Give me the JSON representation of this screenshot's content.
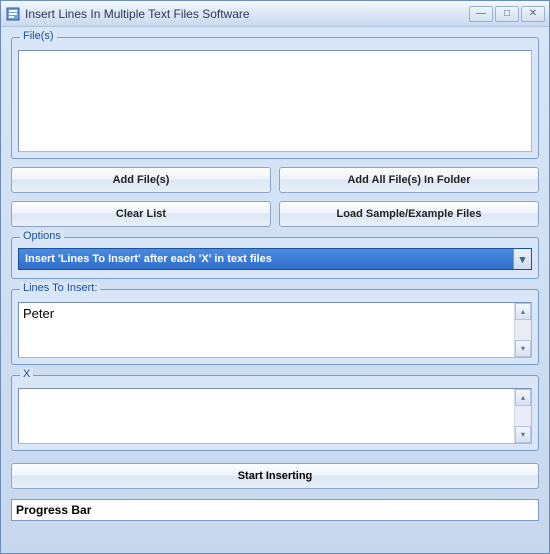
{
  "window": {
    "title": "Insert Lines In Multiple Text Files Software"
  },
  "files": {
    "label": "File(s)"
  },
  "buttons": {
    "add_files": "Add File(s)",
    "add_folder": "Add All File(s) In Folder",
    "clear_list": "Clear List",
    "load_sample": "Load Sample/Example Files",
    "start": "Start Inserting"
  },
  "options": {
    "label": "Options",
    "selected": "Insert 'Lines To Insert' after each 'X' in text files"
  },
  "lines": {
    "label": "Lines To Insert:",
    "value": "Peter"
  },
  "x_section": {
    "label": "X",
    "value": ""
  },
  "progress": {
    "label": "Progress Bar"
  }
}
